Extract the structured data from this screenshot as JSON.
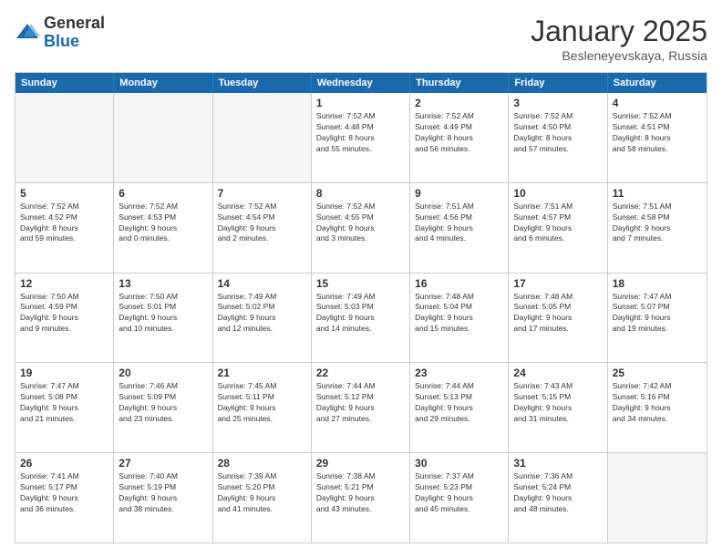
{
  "header": {
    "logo_general": "General",
    "logo_blue": "Blue",
    "month_title": "January 2025",
    "subtitle": "Besleneyevskaya, Russia"
  },
  "weekdays": [
    "Sunday",
    "Monday",
    "Tuesday",
    "Wednesday",
    "Thursday",
    "Friday",
    "Saturday"
  ],
  "rows": [
    [
      {
        "day": "",
        "info": "",
        "empty": true
      },
      {
        "day": "",
        "info": "",
        "empty": true
      },
      {
        "day": "",
        "info": "",
        "empty": true
      },
      {
        "day": "1",
        "info": "Sunrise: 7:52 AM\nSunset: 4:48 PM\nDaylight: 8 hours\nand 55 minutes."
      },
      {
        "day": "2",
        "info": "Sunrise: 7:52 AM\nSunset: 4:49 PM\nDaylight: 8 hours\nand 56 minutes."
      },
      {
        "day": "3",
        "info": "Sunrise: 7:52 AM\nSunset: 4:50 PM\nDaylight: 8 hours\nand 57 minutes."
      },
      {
        "day": "4",
        "info": "Sunrise: 7:52 AM\nSunset: 4:51 PM\nDaylight: 8 hours\nand 58 minutes."
      }
    ],
    [
      {
        "day": "5",
        "info": "Sunrise: 7:52 AM\nSunset: 4:52 PM\nDaylight: 8 hours\nand 59 minutes."
      },
      {
        "day": "6",
        "info": "Sunrise: 7:52 AM\nSunset: 4:53 PM\nDaylight: 9 hours\nand 0 minutes."
      },
      {
        "day": "7",
        "info": "Sunrise: 7:52 AM\nSunset: 4:54 PM\nDaylight: 9 hours\nand 2 minutes."
      },
      {
        "day": "8",
        "info": "Sunrise: 7:52 AM\nSunset: 4:55 PM\nDaylight: 9 hours\nand 3 minutes."
      },
      {
        "day": "9",
        "info": "Sunrise: 7:51 AM\nSunset: 4:56 PM\nDaylight: 9 hours\nand 4 minutes."
      },
      {
        "day": "10",
        "info": "Sunrise: 7:51 AM\nSunset: 4:57 PM\nDaylight: 9 hours\nand 6 minutes."
      },
      {
        "day": "11",
        "info": "Sunrise: 7:51 AM\nSunset: 4:58 PM\nDaylight: 9 hours\nand 7 minutes."
      }
    ],
    [
      {
        "day": "12",
        "info": "Sunrise: 7:50 AM\nSunset: 4:59 PM\nDaylight: 9 hours\nand 9 minutes."
      },
      {
        "day": "13",
        "info": "Sunrise: 7:50 AM\nSunset: 5:01 PM\nDaylight: 9 hours\nand 10 minutes."
      },
      {
        "day": "14",
        "info": "Sunrise: 7:49 AM\nSunset: 5:02 PM\nDaylight: 9 hours\nand 12 minutes."
      },
      {
        "day": "15",
        "info": "Sunrise: 7:49 AM\nSunset: 5:03 PM\nDaylight: 9 hours\nand 14 minutes."
      },
      {
        "day": "16",
        "info": "Sunrise: 7:48 AM\nSunset: 5:04 PM\nDaylight: 9 hours\nand 15 minutes."
      },
      {
        "day": "17",
        "info": "Sunrise: 7:48 AM\nSunset: 5:05 PM\nDaylight: 9 hours\nand 17 minutes."
      },
      {
        "day": "18",
        "info": "Sunrise: 7:47 AM\nSunset: 5:07 PM\nDaylight: 9 hours\nand 19 minutes."
      }
    ],
    [
      {
        "day": "19",
        "info": "Sunrise: 7:47 AM\nSunset: 5:08 PM\nDaylight: 9 hours\nand 21 minutes."
      },
      {
        "day": "20",
        "info": "Sunrise: 7:46 AM\nSunset: 5:09 PM\nDaylight: 9 hours\nand 23 minutes."
      },
      {
        "day": "21",
        "info": "Sunrise: 7:45 AM\nSunset: 5:11 PM\nDaylight: 9 hours\nand 25 minutes."
      },
      {
        "day": "22",
        "info": "Sunrise: 7:44 AM\nSunset: 5:12 PM\nDaylight: 9 hours\nand 27 minutes."
      },
      {
        "day": "23",
        "info": "Sunrise: 7:44 AM\nSunset: 5:13 PM\nDaylight: 9 hours\nand 29 minutes."
      },
      {
        "day": "24",
        "info": "Sunrise: 7:43 AM\nSunset: 5:15 PM\nDaylight: 9 hours\nand 31 minutes."
      },
      {
        "day": "25",
        "info": "Sunrise: 7:42 AM\nSunset: 5:16 PM\nDaylight: 9 hours\nand 34 minutes."
      }
    ],
    [
      {
        "day": "26",
        "info": "Sunrise: 7:41 AM\nSunset: 5:17 PM\nDaylight: 9 hours\nand 36 minutes."
      },
      {
        "day": "27",
        "info": "Sunrise: 7:40 AM\nSunset: 5:19 PM\nDaylight: 9 hours\nand 38 minutes."
      },
      {
        "day": "28",
        "info": "Sunrise: 7:39 AM\nSunset: 5:20 PM\nDaylight: 9 hours\nand 41 minutes."
      },
      {
        "day": "29",
        "info": "Sunrise: 7:38 AM\nSunset: 5:21 PM\nDaylight: 9 hours\nand 43 minutes."
      },
      {
        "day": "30",
        "info": "Sunrise: 7:37 AM\nSunset: 5:23 PM\nDaylight: 9 hours\nand 45 minutes."
      },
      {
        "day": "31",
        "info": "Sunrise: 7:36 AM\nSunset: 5:24 PM\nDaylight: 9 hours\nand 48 minutes."
      },
      {
        "day": "",
        "info": "",
        "empty": true
      }
    ]
  ]
}
